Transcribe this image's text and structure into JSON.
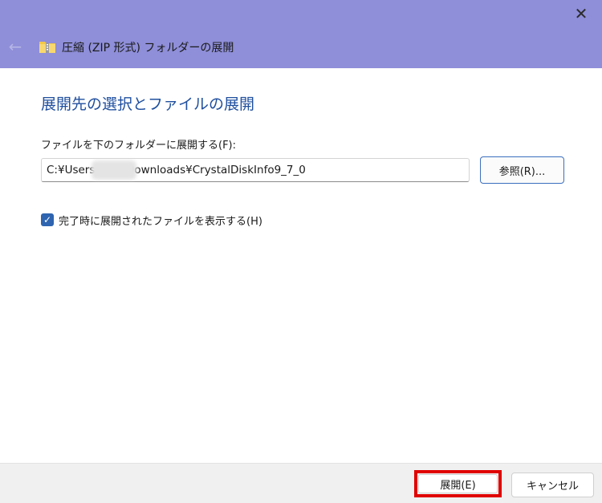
{
  "window": {
    "title": "圧縮 (ZIP 形式) フォルダーの展開",
    "back_icon": "arrow-left-icon",
    "close_icon": "close-icon",
    "title_icon": "zip-folder-icon",
    "titlebar_color": "#8e8ed9"
  },
  "main": {
    "heading": "展開先の選択とファイルの展開",
    "destination_label": "ファイルを下のフォルダーに展開する(F):",
    "destination_path": "C:¥Users         Downloads¥CrystalDiskInfo9_7_0",
    "browse_label": "参照(R)...",
    "show_files_label": "完了時に展開されたファイルを表示する(H)",
    "show_files_checked": true,
    "accent_color": "#1f4f9e"
  },
  "footer": {
    "extract_label": "展開(E)",
    "cancel_label": "キャンセル",
    "highlight_color": "#e00000"
  }
}
